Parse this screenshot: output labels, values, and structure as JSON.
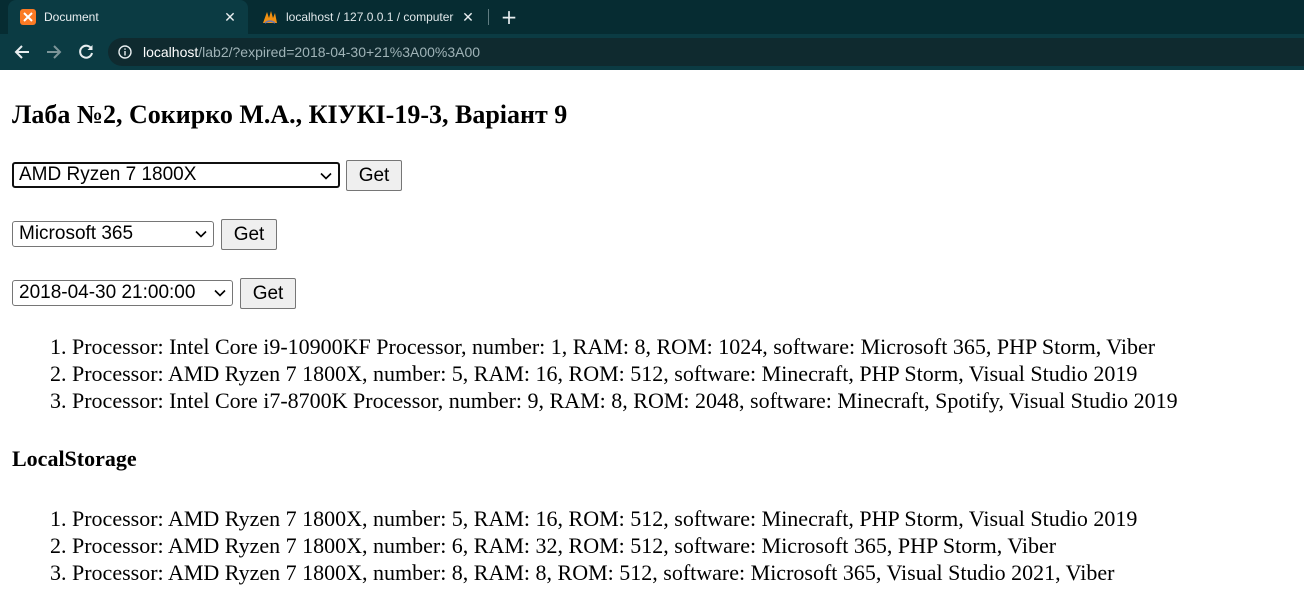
{
  "browser": {
    "tabs": [
      {
        "title": "Document",
        "active": true,
        "icon": "xampp-icon"
      },
      {
        "title": "localhost / 127.0.0.1 / computer |",
        "active": false,
        "icon": "phpmyadmin-icon"
      }
    ],
    "url": {
      "host": "localhost",
      "path": "/lab2/?expired=2018-04-30+21%3A00%3A00"
    }
  },
  "page": {
    "title": "Лаба №2, Сокирко М.А., КІУКІ-19-3, Варіант 9",
    "forms": [
      {
        "selected": "AMD Ryzen 7 1800X",
        "button": "Get"
      },
      {
        "selected": "Microsoft 365",
        "button": "Get"
      },
      {
        "selected": "2018-04-30 21:00:00",
        "button": "Get"
      }
    ],
    "results": [
      "Processor: Intel Core i9-10900KF Processor, number: 1, RAM: 8, ROM: 1024, software: Microsoft 365, PHP Storm, Viber",
      "Processor: AMD Ryzen 7 1800X, number: 5, RAM: 16, ROM: 512, software: Minecraft, PHP Storm, Visual Studio 2019",
      "Processor: Intel Core i7-8700K Processor, number: 9, RAM: 8, ROM: 2048, software: Minecraft, Spotify, Visual Studio 2019"
    ],
    "local_storage_title": "LocalStorage",
    "local_storage": [
      "Processor: AMD Ryzen 7 1800X, number: 5, RAM: 16, ROM: 512, software: Minecraft, PHP Storm, Visual Studio 2019",
      "Processor: AMD Ryzen 7 1800X, number: 6, RAM: 32, ROM: 512, software: Microsoft 365, PHP Storm, Viber",
      "Processor: AMD Ryzen 7 1800X, number: 8, RAM: 8, ROM: 512, software: Microsoft 365, Visual Studio 2021, Viber"
    ]
  },
  "colors": {
    "tabstrip": "#062c32",
    "toolbar": "#0b3b43",
    "omnibox": "#0f2a2f",
    "xampp_orange": "#fb7a24"
  }
}
